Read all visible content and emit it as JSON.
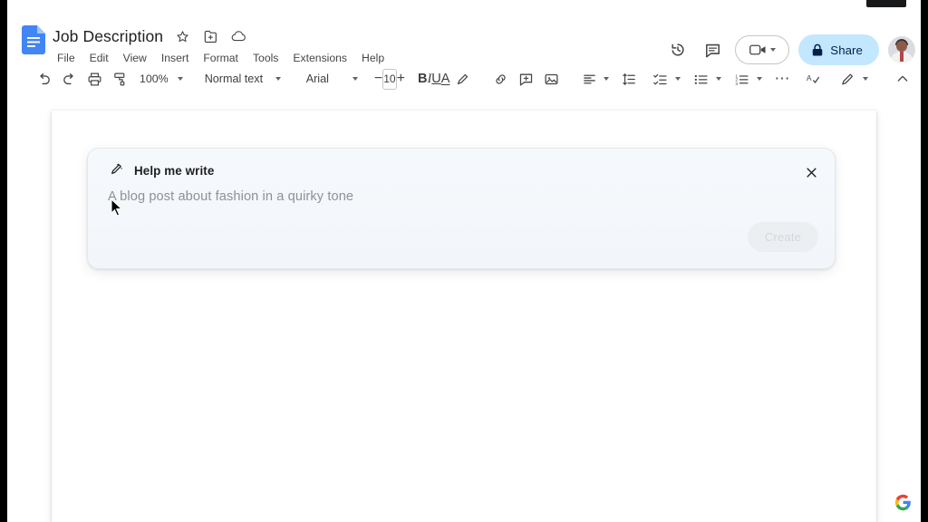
{
  "window": {
    "app": "Google Docs"
  },
  "header": {
    "doc_icon": "google-docs-icon",
    "title": "Job Description",
    "title_actions": [
      {
        "name": "star-icon",
        "label": "Star"
      },
      {
        "name": "move-to-folder-icon",
        "label": "Move"
      },
      {
        "name": "cloud-saved-icon",
        "label": "Saved to Drive"
      }
    ],
    "menus": [
      "File",
      "Edit",
      "View",
      "Insert",
      "Format",
      "Tools",
      "Extensions",
      "Help"
    ],
    "right_actions": [
      {
        "name": "version-history-icon",
        "label": "Version history"
      },
      {
        "name": "comment-icon",
        "label": "Comments"
      }
    ],
    "meet": {
      "icon": "video-camera-icon",
      "caret": "▾"
    },
    "share": {
      "icon": "lock-icon",
      "label": "Share",
      "color": "#c2e7ff"
    },
    "avatar": "user-avatar"
  },
  "toolbar": {
    "undo": "↶",
    "redo": "↷",
    "print": "print-icon",
    "paint_format": "paint-format-icon",
    "zoom": "100%",
    "text_style": "Normal text",
    "font": "Arial",
    "font_size": "10",
    "decrease": "−",
    "increase": "+",
    "bold": "B",
    "italic": "I",
    "underline": "U",
    "text_color": "A",
    "highlight": "highlight-pen-icon",
    "link": "link-icon",
    "comment": "add-comment-icon",
    "image": "insert-image-icon",
    "align": "align-left-icon",
    "line_spacing": "line-spacing-icon",
    "checklist": "checklist-icon",
    "bulleted_list": "bulleted-list-icon",
    "numbered_list": "numbered-list-icon",
    "more": "⋯",
    "spelling": "spelling-check-icon",
    "editing_mode": "editing-pencil-icon",
    "collapse": "collapse-chevron-icon"
  },
  "help_me_write": {
    "icon": "magic-pen-icon",
    "title": "Help me write",
    "prompt_placeholder": "A blog post about fashion in a quirky tone",
    "prompt_value": "",
    "create_label": "Create",
    "create_enabled": false,
    "close_icon": "close-icon"
  },
  "footer": {
    "google_logo": "google-g-logo"
  },
  "colors": {
    "docs_blue": "#4285f4",
    "share_blue": "#c2e7ff",
    "card_bg": "#f4f8fb",
    "placeholder_grey": "#8d9197"
  }
}
